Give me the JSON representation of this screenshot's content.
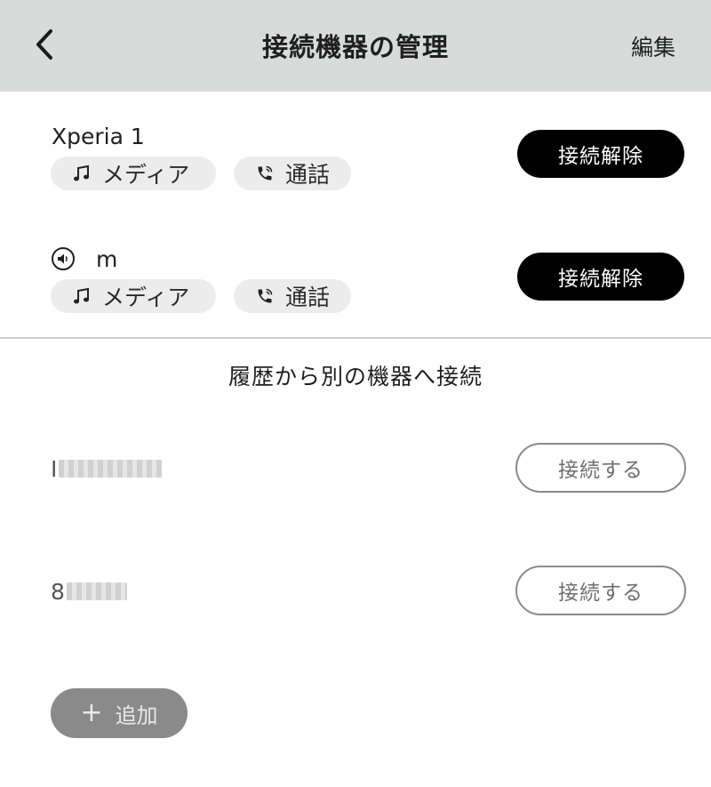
{
  "header": {
    "title": "接続機器の管理",
    "edit_label": "編集"
  },
  "connected_devices": [
    {
      "name": "Xperia 1",
      "has_speaker_icon": false,
      "chips": [
        "メディア",
        "通話"
      ],
      "action_label": "接続解除"
    },
    {
      "name": "m",
      "has_speaker_icon": true,
      "chips": [
        "メディア",
        "通話"
      ],
      "action_label": "接続解除"
    }
  ],
  "history": {
    "title": "履歴から別の機器へ接続",
    "items": [
      {
        "name_prefix": "I",
        "action_label": "接続する"
      },
      {
        "name_prefix": "8",
        "action_label": "接続する"
      }
    ]
  },
  "add_button": {
    "label": "追加"
  },
  "icons": {
    "back": "chevron-left-icon",
    "media": "music-note-icon",
    "call": "phone-icon",
    "speaker": "speaker-icon",
    "add": "plus-icon"
  },
  "colors": {
    "header_bg": "#d9dbda",
    "primary_button": "#000000",
    "add_button": "#8a8a8a"
  }
}
